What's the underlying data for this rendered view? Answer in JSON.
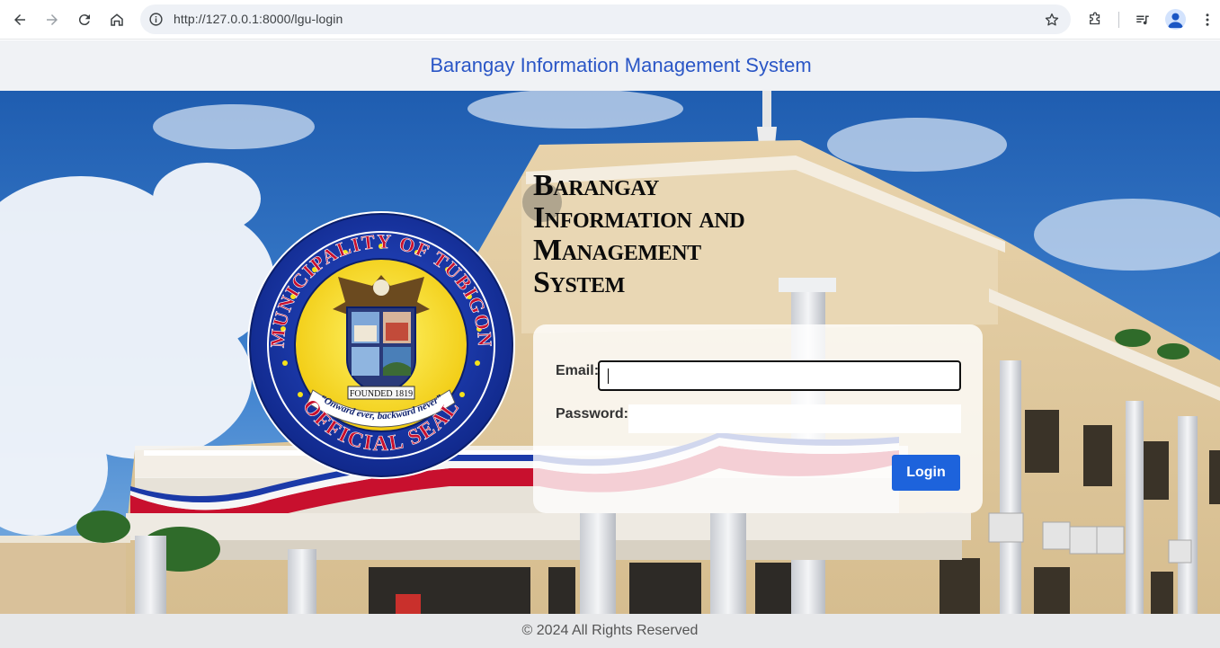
{
  "browser": {
    "url": "http://127.0.0.1:8000/lgu-login",
    "icons": [
      "back-arrow-icon",
      "forward-arrow-icon",
      "reload-icon",
      "home-icon",
      "site-info-icon",
      "bookmark-star-icon",
      "extensions-icon",
      "media-controls-icon",
      "profile-icon",
      "more-menu-icon"
    ]
  },
  "header": {
    "title": "Barangay Information Management System"
  },
  "seal": {
    "top_text": "MUNICIPALITY OF TUBIGON",
    "bottom_text": "OFFICIAL SEAL",
    "ribbon_text": "“Onward ever, backward never”",
    "founded_text": "FOUNDED 1819"
  },
  "system_title": {
    "line1": "Barangay",
    "line2": "Information and",
    "line3": "Management",
    "line4": "System"
  },
  "login_form": {
    "email_label": "Email:",
    "email_value": "",
    "password_label": "Password:",
    "password_value": "",
    "login_button": "Login"
  },
  "footer": {
    "text": "© 2024 All Rights Reserved"
  },
  "colors": {
    "header_title": "#2a56c6",
    "login_button": "#1d63dc",
    "seal_blue": "#1b3aa8",
    "seal_red": "#c8102e",
    "seal_yellow": "#f5e21a"
  }
}
